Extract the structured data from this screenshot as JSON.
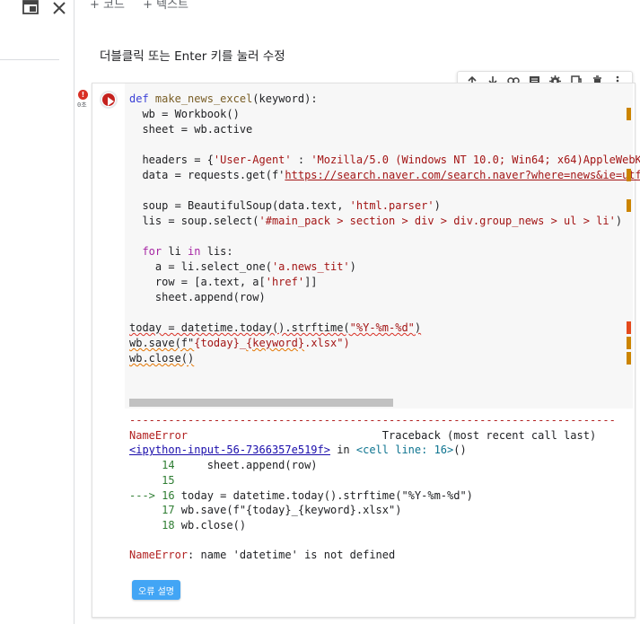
{
  "toolbar": {
    "add_code": "+ 코드",
    "add_text": "+ 텍스트"
  },
  "text_cell": {
    "placeholder": "더블클릭 또는 Enter 키를 눌러 수정"
  },
  "cell": {
    "exec_count": "0초",
    "error_badge": "!",
    "toolbar_icons": [
      "arrow-up-icon",
      "arrow-down-icon",
      "link-icon",
      "comment-icon",
      "settings-icon",
      "mirror-cell-icon",
      "delete-icon",
      "more-vert-icon"
    ]
  },
  "code_lines": {
    "l1_def": "def",
    "l1_fn": "make_news_excel",
    "l1_rest": "(keyword):",
    "l2": "  wb = Workbook()",
    "l3": "  sheet = wb.active",
    "l4": "",
    "l5_a": "  headers = {",
    "l5_b": "'User-Agent'",
    "l5_c": " : ",
    "l5_d": "'Mozilla/5.0 (Windows NT 10.0; Win64; x64)AppleWebKi",
    "l6_a": "  data = requests.get(f'",
    "l6_b": "https://search.naver.com/search.naver?where=news&ie=utf",
    "l7": "",
    "l8_a": "  soup = BeautifulSoup(data.text, ",
    "l8_b": "'html.parser'",
    "l8_c": ")",
    "l9_a": "  lis = soup.select(",
    "l9_b": "'#main_pack > section > div > div.group_news > ul > li'",
    "l9_c": ")",
    "l10": "",
    "l11_a": "  ",
    "l11_for": "for",
    "l11_b": " li ",
    "l11_in": "in",
    "l11_c": " lis:",
    "l12_a": "    a = li.select_one(",
    "l12_b": "'a.news_tit'",
    "l12_c": ")",
    "l13_a": "    row = [a.text, a[",
    "l13_b": "'href'",
    "l13_c": "]]",
    "l14": "    sheet.append(row)",
    "l15": "",
    "l16_a": "today = datetime.today().strftime(",
    "l16_b": "\"%Y-%m-%d\"",
    "l16_c": ")",
    "l17_a": "wb.save(f\"",
    "l17_b": "{today}",
    "l17_c": "_",
    "l17_d": "{keyword}",
    "l17_e": ".xlsx\")",
    "l18": "wb.close()"
  },
  "output": {
    "dashes": "---------------------------------------------------------------------------",
    "err_name": "NameError",
    "traceback": "                              Traceback (most recent call last)",
    "input_link": "<ipython-input-56-7366357e519f>",
    "in_text": " in ",
    "cell_line": "<cell line: 16>",
    "parens": "()",
    "t14_num": "     14",
    "t14_code": "     sheet.append(row)",
    "t15_num": "     15",
    "t16_arrow": "---> 16",
    "t16_code": " today = datetime.today().strftime(\"%Y-%m-%d\")",
    "t17_num": "     17",
    "t17_code": " wb.save(f\"{today}_{keyword}.xlsx\")",
    "t18_num": "     18",
    "t18_code": " wb.close()",
    "final_name": "NameError",
    "final_msg": ": name 'datetime' is not defined"
  },
  "explain_button": "오류 설명"
}
